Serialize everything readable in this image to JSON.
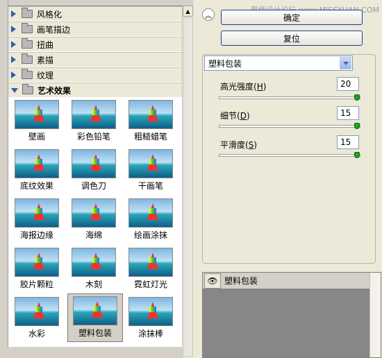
{
  "watermark": "思缘设计论坛 www.MISSYUAN.COM",
  "categories": [
    {
      "label": "风格化",
      "open": false
    },
    {
      "label": "画笔描边",
      "open": false
    },
    {
      "label": "扭曲",
      "open": false
    },
    {
      "label": "素描",
      "open": false
    },
    {
      "label": "纹理",
      "open": false
    },
    {
      "label": "艺术效果",
      "open": true
    }
  ],
  "thumbnails": [
    {
      "label": "壁画"
    },
    {
      "label": "彩色铅笔"
    },
    {
      "label": "粗糙蜡笔"
    },
    {
      "label": "底纹效果"
    },
    {
      "label": "调色刀"
    },
    {
      "label": "干画笔"
    },
    {
      "label": "海报边缘"
    },
    {
      "label": "海绵"
    },
    {
      "label": "绘画涂抹"
    },
    {
      "label": "胶片颗粒"
    },
    {
      "label": "木刻"
    },
    {
      "label": "霓虹灯光"
    },
    {
      "label": "水彩"
    },
    {
      "label": "塑料包装",
      "selected": true
    },
    {
      "label": "涂抹棒"
    }
  ],
  "buttons": {
    "ok": "确定",
    "reset": "复位"
  },
  "filter_select": {
    "value": "塑料包装"
  },
  "params": [
    {
      "label": "高光强度",
      "key": "H",
      "value": "20",
      "level_fraction": 1.0
    },
    {
      "label": "细节",
      "key": "D",
      "value": "15",
      "level_fraction": 1.0
    },
    {
      "label": "平滑度",
      "key": "S",
      "value": "15",
      "level_fraction": 1.0
    }
  ],
  "layers": {
    "name": "塑料包装"
  },
  "colors": {
    "accent": "#1c3f94",
    "knob": "#21a121",
    "tree_triangle": "#315fa8"
  }
}
